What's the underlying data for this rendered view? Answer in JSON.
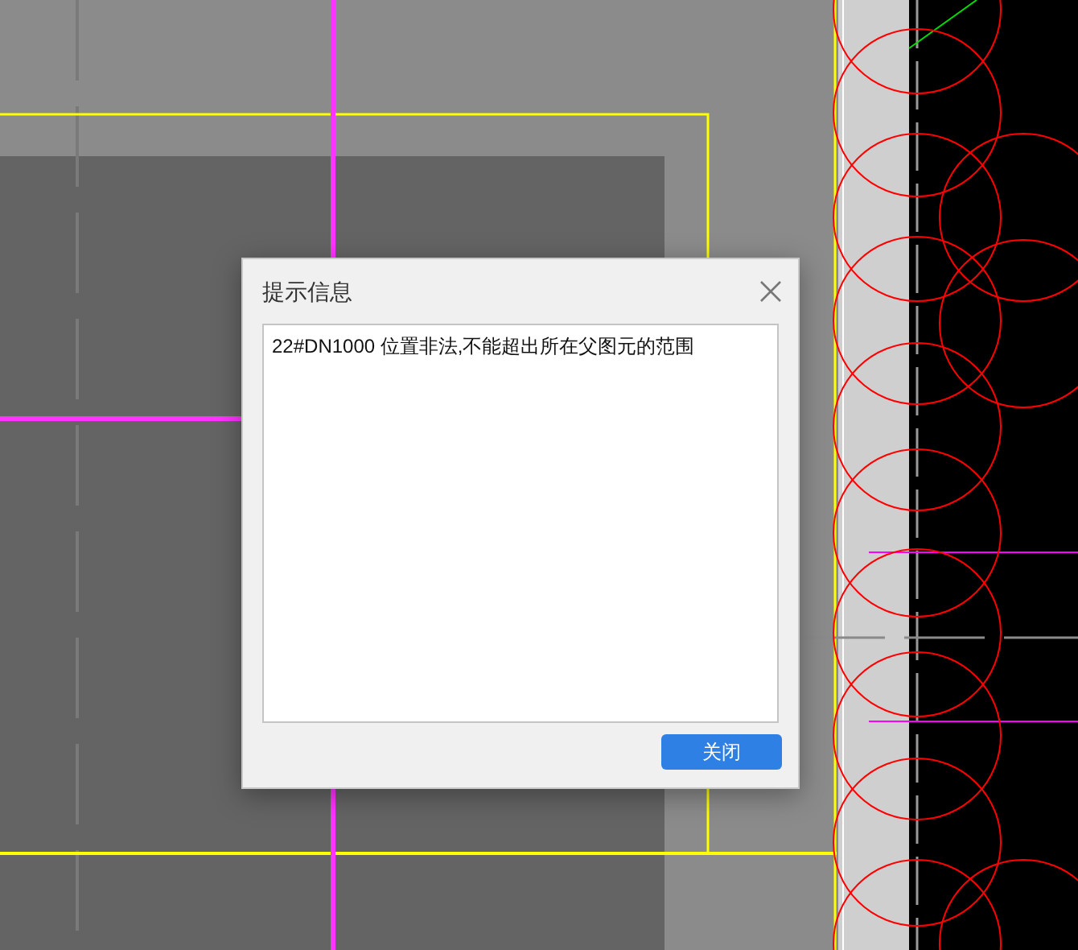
{
  "dialog": {
    "title": "提示信息",
    "message": "22#DN1000 位置非法,不能超出所在父图元的范围",
    "buttons": [
      {
        "label": "关闭",
        "kind": "primary"
      }
    ]
  }
}
